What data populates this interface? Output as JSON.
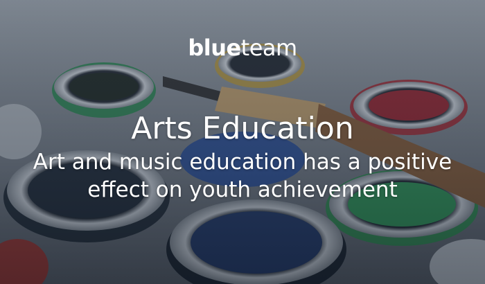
{
  "logo": {
    "bold": "blue",
    "light": "team"
  },
  "hero": {
    "title": "Arts Education",
    "subtitle": "Art and music education has a positive effect on youth achievement"
  },
  "colors": {
    "overlay": "#2a3440",
    "text": "#ffffff",
    "paint_red": "#b0242c",
    "paint_green": "#2f8a4a",
    "paint_blue": "#1f3f8a",
    "paint_yellow": "#c9a230",
    "brush_handle": "#8a5a30"
  }
}
